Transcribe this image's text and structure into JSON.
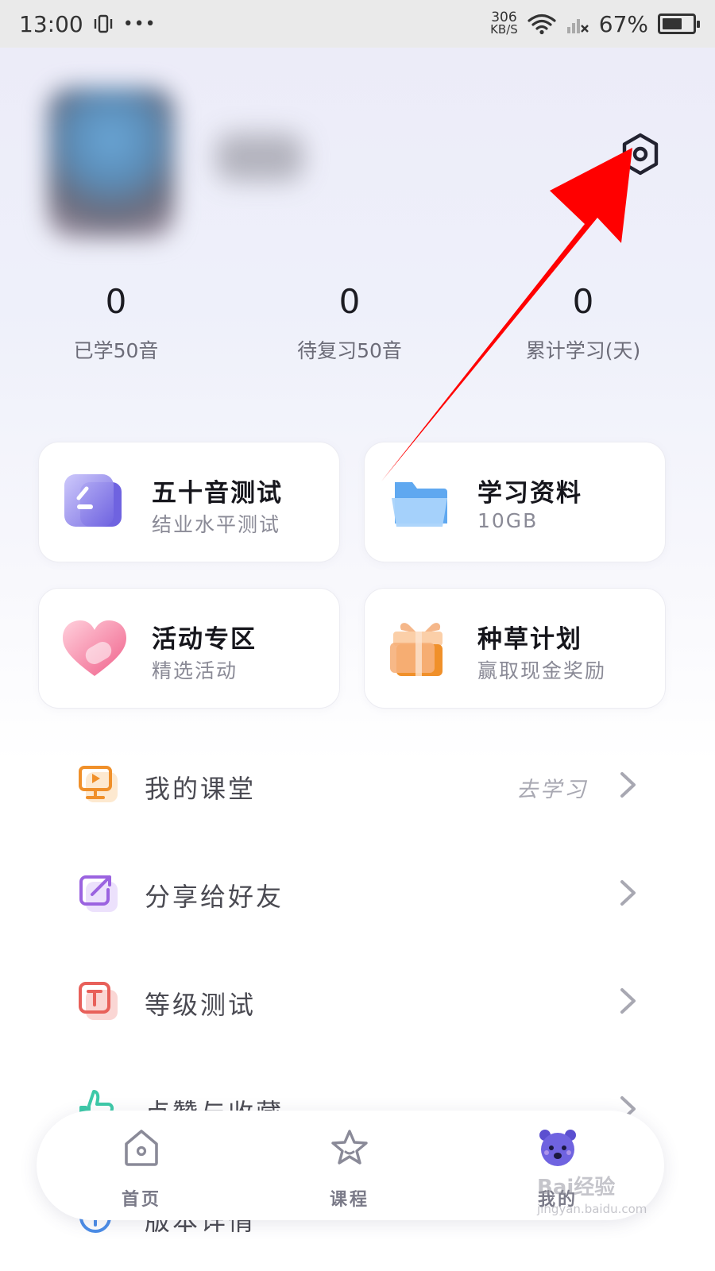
{
  "status_bar": {
    "time": "13:00",
    "dots": "•••",
    "net_speed_value": "306",
    "net_speed_unit": "KB/S",
    "battery_percent": "67%",
    "battery_level": 0.67
  },
  "profile": {
    "settings_icon": "gear-hexagon-icon"
  },
  "stats": [
    {
      "value": "0",
      "label": "已学50音"
    },
    {
      "value": "0",
      "label": "待复习50音"
    },
    {
      "value": "0",
      "label": "累计学习(天)"
    }
  ],
  "cards": [
    {
      "title": "五十音测试",
      "subtitle": "结业水平测试",
      "icon": "test-card-icon"
    },
    {
      "title": "学习资料",
      "subtitle": "10GB",
      "icon": "folder-icon"
    },
    {
      "title": "活动专区",
      "subtitle": "精选活动",
      "icon": "heart-icon"
    },
    {
      "title": "种草计划",
      "subtitle": "赢取现金奖励",
      "icon": "gift-icon"
    }
  ],
  "list": [
    {
      "label": "我的课堂",
      "extra": "去学习",
      "icon": "classroom-icon"
    },
    {
      "label": "分享给好友",
      "extra": "",
      "icon": "share-icon"
    },
    {
      "label": "等级测试",
      "extra": "",
      "icon": "level-test-icon"
    },
    {
      "label": "点赞与收藏",
      "extra": "",
      "icon": "like-icon"
    },
    {
      "label": "版本详情",
      "extra": "",
      "icon": "info-icon"
    }
  ],
  "nav": [
    {
      "label": "首页",
      "icon": "home-icon"
    },
    {
      "label": "课程",
      "icon": "star-icon"
    },
    {
      "label": "我的",
      "icon": "bear-avatar-icon"
    }
  ],
  "colors": {
    "accent_purple": "#6f63e0",
    "arrow_red": "#ff0000",
    "classroom_orange": "#f0902a",
    "share_purple": "#9b63e0",
    "level_red": "#e8605a",
    "like_green": "#3dc9a8",
    "info_blue": "#4b8de8"
  },
  "watermark": {
    "text": "Bai经验",
    "url": "jingyan.baidu.com"
  }
}
